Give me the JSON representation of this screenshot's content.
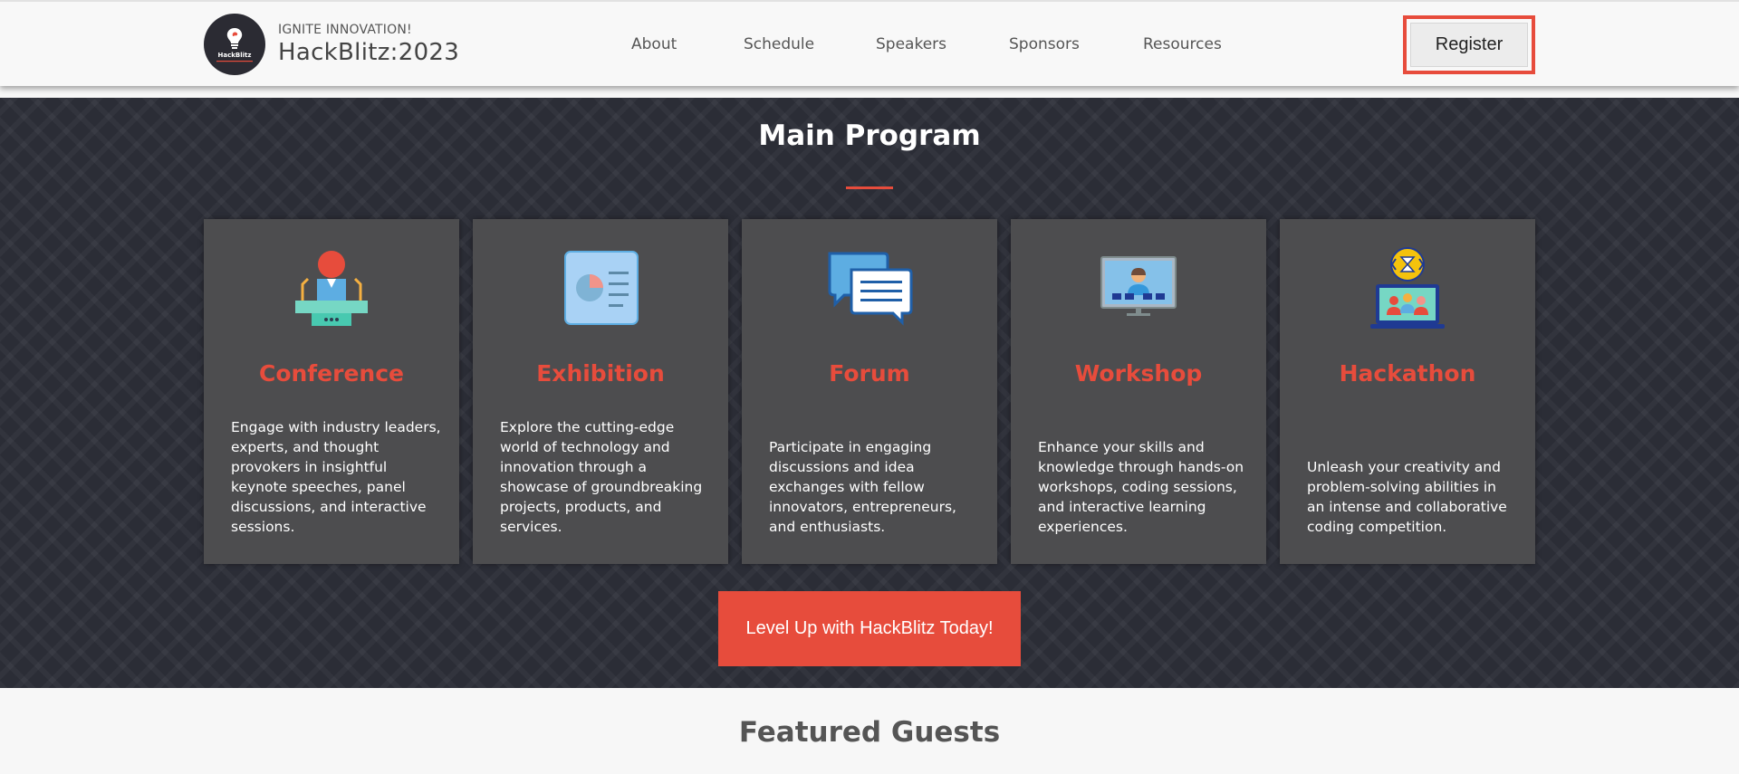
{
  "header": {
    "logo": {
      "text": "HackBlitz"
    },
    "tagline": "IGNITE INNOVATION!",
    "brand_name": "HackBlitz:2023",
    "nav": [
      {
        "label": "About"
      },
      {
        "label": "Schedule"
      },
      {
        "label": "Speakers"
      },
      {
        "label": "Sponsors"
      },
      {
        "label": "Resources"
      }
    ],
    "register_label": "Register"
  },
  "program": {
    "title": "Main Program",
    "cards": [
      {
        "icon": "podium-speaker-icon",
        "title": "Conference",
        "description": "Engage with industry leaders, experts, and thought provokers in insightful keynote speeches, panel discussions, and interactive sessions."
      },
      {
        "icon": "presentation-board-icon",
        "title": "Exhibition",
        "description": "Explore the cutting-edge world of technology and innovation through a showcase of groundbreaking projects, products, and services."
      },
      {
        "icon": "chat-bubbles-icon",
        "title": "Forum",
        "description": "Participate in engaging discussions and idea exchanges with fellow innovators, entrepreneurs, and enthusiasts."
      },
      {
        "icon": "video-monitor-icon",
        "title": "Workshop",
        "description": "Enhance your skills and knowledge through hands-on workshops, coding sessions, and interactive learning experiences."
      },
      {
        "icon": "laptop-team-code-icon",
        "title": "Hackathon",
        "description": "Unleash your creativity and problem-solving abilities in an intense and collaborative coding competition."
      }
    ],
    "cta_label": "Level Up with HackBlitz Today!"
  },
  "featured": {
    "title": "Featured Guests"
  },
  "colors": {
    "accent": "#e74c3c",
    "section_bg": "#2b2d36",
    "card_bg": "#4d4d4f",
    "header_bg": "#f8f8f8"
  }
}
